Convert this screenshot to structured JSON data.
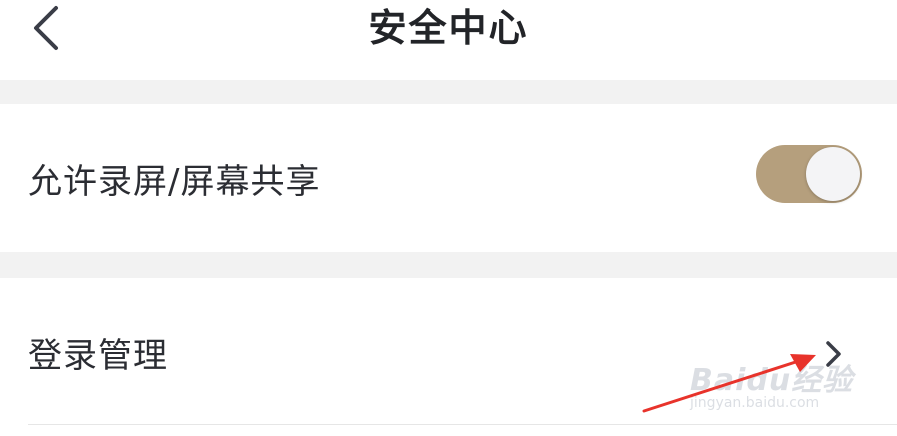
{
  "header": {
    "title": "安全中心",
    "back_icon": "chevron-left-icon"
  },
  "settings": {
    "screen_sharing": {
      "label": "允许录屏/屏幕共享",
      "enabled": true,
      "toggle_color": "#b59f7d"
    },
    "login_management": {
      "label": "登录管理",
      "chevron_icon": "chevron-right-icon"
    }
  },
  "annotation": {
    "arrow_color": "#e8332b"
  },
  "watermark": {
    "brand": "Baidu经验",
    "url": "jingyan.baidu.com"
  }
}
